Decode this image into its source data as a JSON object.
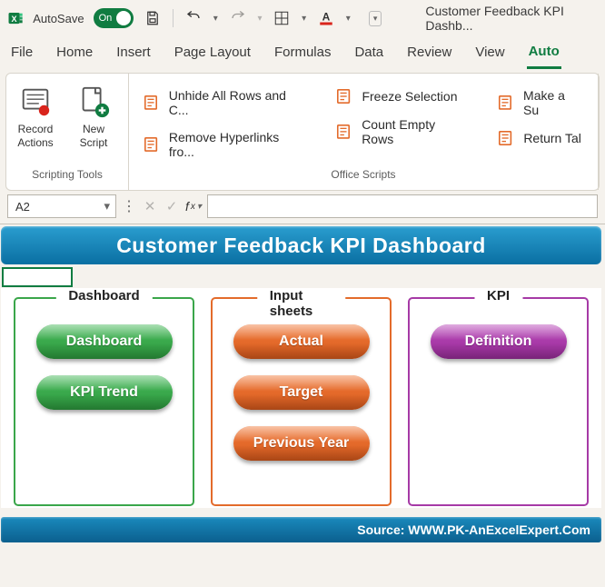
{
  "titlebar": {
    "autosave_label": "AutoSave",
    "autosave_state": "On",
    "doc_title": "Customer Feedback KPI Dashb..."
  },
  "tabs": {
    "items": [
      "File",
      "Home",
      "Insert",
      "Page Layout",
      "Formulas",
      "Data",
      "Review",
      "View",
      "Auto"
    ],
    "active_index": 8
  },
  "ribbon": {
    "scripting_group_label": "Scripting Tools",
    "record_label": "Record Actions",
    "new_script_label": "New Script",
    "office_scripts_label": "Office Scripts",
    "scripts_col1": [
      "Unhide All Rows and C...",
      "Remove Hyperlinks fro..."
    ],
    "scripts_col2": [
      "Freeze Selection",
      "Count Empty Rows"
    ],
    "scripts_col3": [
      "Make a Su",
      "Return Tal"
    ]
  },
  "formula_bar": {
    "name_box": "A2",
    "value": ""
  },
  "sheet": {
    "banner_title": "Customer Feedback KPI Dashboard",
    "footer_text": "Source: WWW.PK-AnExcelExpert.Com",
    "col1": {
      "title": "Dashboard",
      "items": [
        "Dashboard",
        "KPI Trend"
      ]
    },
    "col2": {
      "title": "Input sheets",
      "items": [
        "Actual",
        "Target",
        "Previous Year"
      ]
    },
    "col3": {
      "title": "KPI",
      "items": [
        "Definition"
      ]
    }
  }
}
